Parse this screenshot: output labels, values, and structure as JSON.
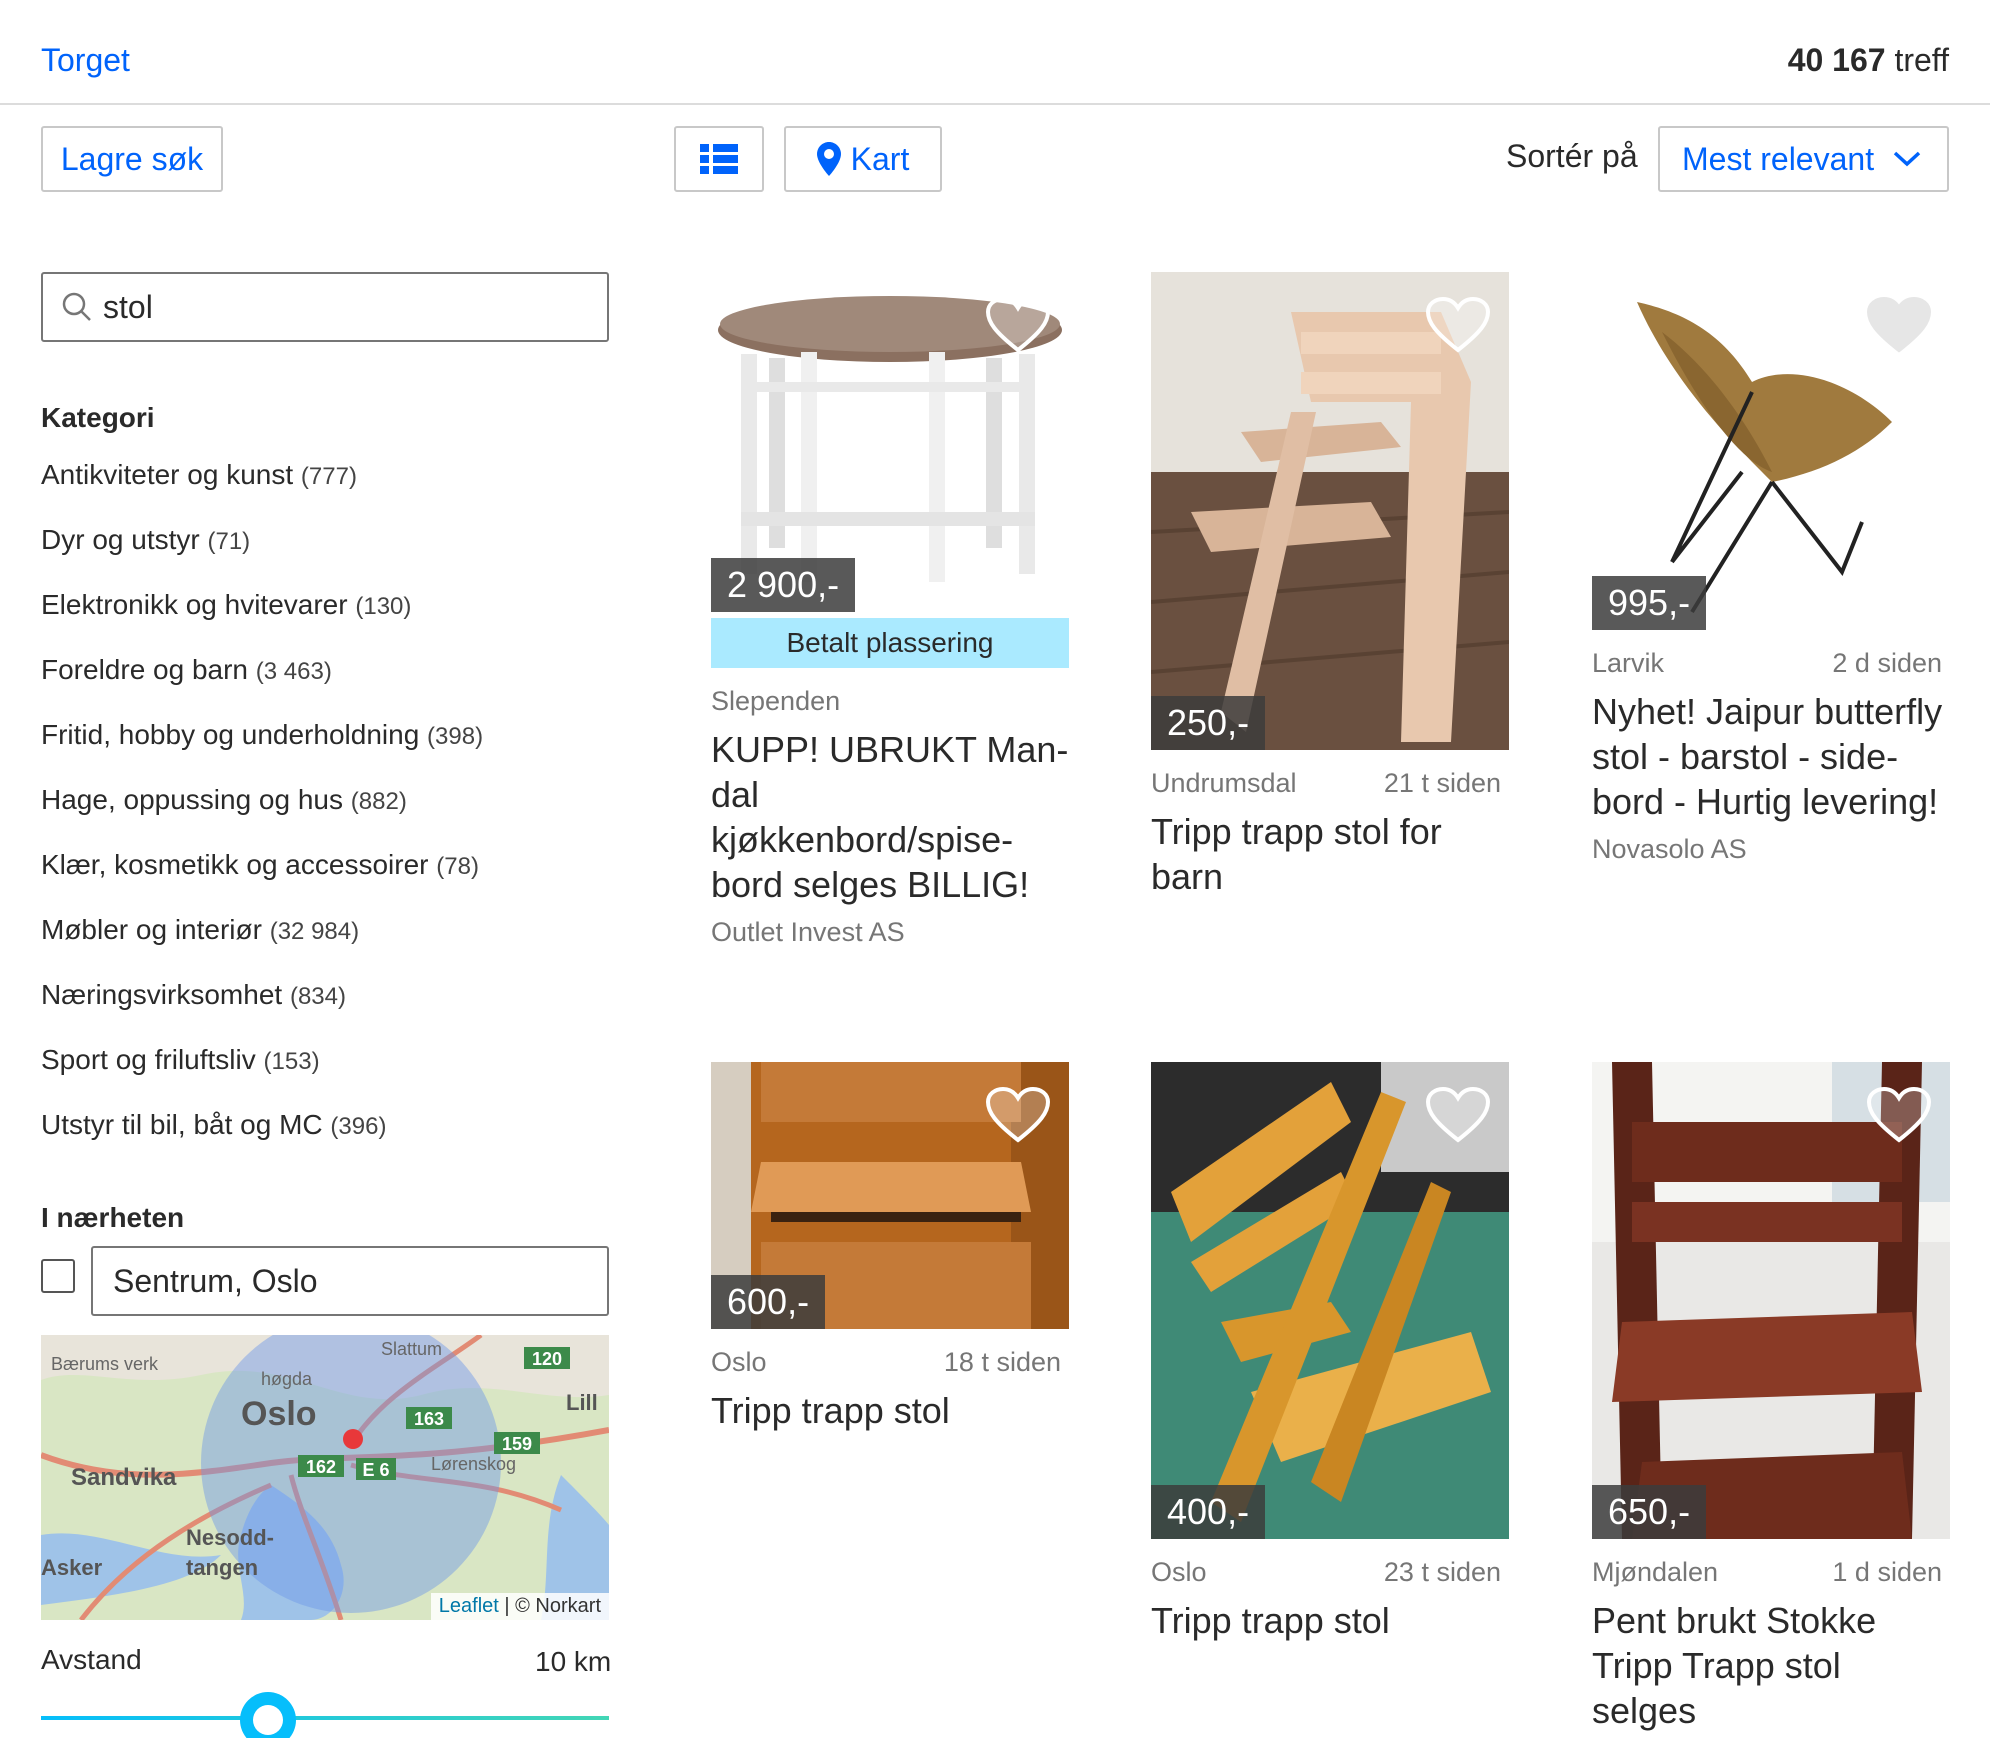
{
  "header": {
    "breadcrumb": "Torget",
    "hit_count": "40 167",
    "hit_suffix": " treff"
  },
  "toolbar": {
    "save_search": "Lagre søk",
    "map_label": "Kart",
    "sort_label": "Sortér på",
    "sort_value": "Mest relevant"
  },
  "search": {
    "value": "stol"
  },
  "filters": {
    "category_heading": "Kategori",
    "categories": [
      {
        "label": "Antikviteter og kunst",
        "count": "(777)"
      },
      {
        "label": "Dyr og utstyr",
        "count": "(71)"
      },
      {
        "label": "Elektronikk og hvitevarer",
        "count": "(130)"
      },
      {
        "label": "Foreldre og barn",
        "count": "(3 463)"
      },
      {
        "label": "Fritid, hobby og underholdning",
        "count": "(398)"
      },
      {
        "label": "Hage, oppussing og hus",
        "count": "(882)"
      },
      {
        "label": "Klær, kosmetikk og accessoirer",
        "count": "(78)"
      },
      {
        "label": "Møbler og interiør",
        "count": "(32 984)"
      },
      {
        "label": "Næringsvirksomhet",
        "count": "(834)"
      },
      {
        "label": "Sport og friluftsliv",
        "count": "(153)"
      },
      {
        "label": "Utstyr til bil, båt og MC",
        "count": "(396)"
      }
    ],
    "nearby_heading": "I nærheten",
    "location": "Sentrum, Oslo",
    "map": {
      "leaflet": "Leaflet",
      "copyright": " | © Norkart",
      "places": [
        "Slattum",
        "Bærums verk",
        "Oslo",
        "Sandvika",
        "Asker",
        "Nesodd-",
        "tangen",
        "Lørenskog",
        "høgda",
        "Lill"
      ],
      "roads": [
        "120",
        "163",
        "159",
        "162",
        "E 6"
      ]
    },
    "distance_label": "Avstand",
    "distance_value": "10 km",
    "distance_fraction": 0.4
  },
  "listings": [
    {
      "price": "2 900,-",
      "paid": "Betalt plassering",
      "location": "Slependen",
      "time": "",
      "title": "KUPP! UBRUKT Man-dal kjøkkenbord/spise-bord selges BILLIG!",
      "seller": "Outlet Invest AS"
    },
    {
      "price": "250,-",
      "location": "Undrumsdal",
      "time": "21 t siden",
      "title": "Tripp trapp stol for barn",
      "seller": ""
    },
    {
      "price": "995,-",
      "location": "Larvik",
      "time": "2 d siden",
      "title": "Nyhet! Jaipur butterfly stol - barstol - side-bord - Hurtig levering!",
      "seller": "Novasolo AS"
    },
    {
      "price": "600,-",
      "location": "Oslo",
      "time": "18 t siden",
      "title": "Tripp trapp stol",
      "seller": ""
    },
    {
      "price": "400,-",
      "location": "Oslo",
      "time": "23 t siden",
      "title": "Tripp trapp stol",
      "seller": ""
    },
    {
      "price": "650,-",
      "location": "Mjøndalen",
      "time": "1 d siden",
      "title": "Pent brukt Stokke Tripp Trapp stol selges",
      "seller": ""
    }
  ],
  "colors": {
    "link": "#0063fb",
    "paid_badge": "#aaeaff",
    "slider": "#06befb"
  }
}
